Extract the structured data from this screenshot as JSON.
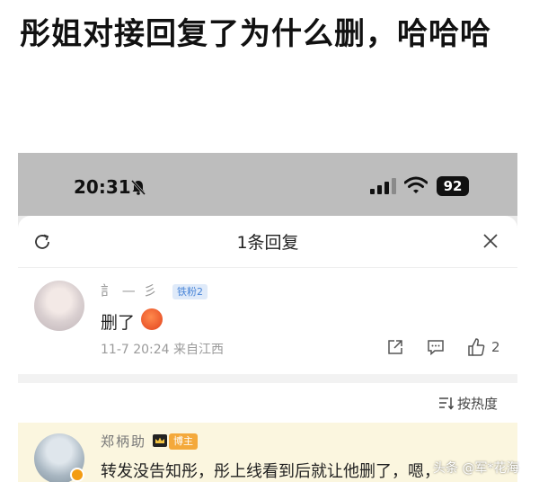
{
  "headline": "彤姐对接回复了为什么删，哈哈哈",
  "status_bar": {
    "time": "20:31",
    "battery": "92"
  },
  "sheet": {
    "title": "1条回复"
  },
  "comment": {
    "username": "訁  —  彡",
    "fan_badge": "铁粉2",
    "text": "删了",
    "meta": "11-7 20:24 来自江西",
    "like_count": "2"
  },
  "sort": {
    "label": "按热度"
  },
  "reply": {
    "username": "郑柄助",
    "rank_badge": "博主",
    "text": "转发没告知彤，彤上线看到后就让他删了，嗯，"
  },
  "watermark": "头条 @军*花海",
  "colors": {
    "accent_blue": "#4a86d8",
    "badge_orange": "#f4a93b",
    "highlight_bg": "#fbf6df"
  }
}
